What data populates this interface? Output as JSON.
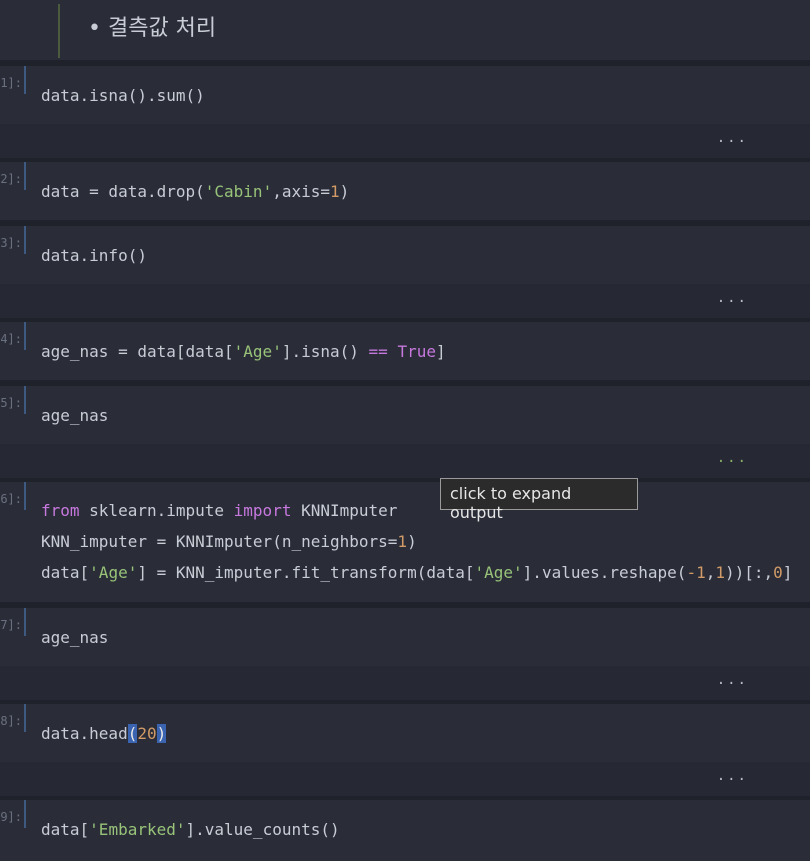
{
  "markdown": {
    "heading": "• 결측값 처리"
  },
  "cells": [
    {
      "prompt": "1]:",
      "lines": [
        [
          {
            "t": "data.isna().sum()",
            "c": ""
          }
        ]
      ],
      "output": "..."
    },
    {
      "prompt": "2]:",
      "lines": [
        [
          {
            "t": "data = data.drop(",
            "c": ""
          },
          {
            "t": "'Cabin'",
            "c": "st"
          },
          {
            "t": ",axis=",
            "c": ""
          },
          {
            "t": "1",
            "c": "nm"
          },
          {
            "t": ")",
            "c": ""
          }
        ]
      ]
    },
    {
      "prompt": "3]:",
      "lines": [
        [
          {
            "t": "data.info()",
            "c": ""
          }
        ]
      ],
      "output": "..."
    },
    {
      "prompt": "4]:",
      "lines": [
        [
          {
            "t": "age_nas = data[data[",
            "c": ""
          },
          {
            "t": "'Age'",
            "c": "st"
          },
          {
            "t": "].isna() ",
            "c": ""
          },
          {
            "t": "==",
            "c": "op"
          },
          {
            "t": " ",
            "c": ""
          },
          {
            "t": "True",
            "c": "kw"
          },
          {
            "t": "]",
            "c": ""
          }
        ]
      ]
    },
    {
      "prompt": "5]:",
      "lines": [
        [
          {
            "t": "age_nas",
            "c": ""
          }
        ]
      ],
      "output": "..."
    },
    {
      "prompt": "6]:",
      "lines": [
        [
          {
            "t": "from",
            "c": "kw"
          },
          {
            "t": " sklearn.impute ",
            "c": ""
          },
          {
            "t": "import",
            "c": "kw"
          },
          {
            "t": " KNNImputer",
            "c": ""
          }
        ],
        [
          {
            "t": "KNN_imputer = KNNImputer(n_neighbors=",
            "c": ""
          },
          {
            "t": "1",
            "c": "nm"
          },
          {
            "t": ")",
            "c": ""
          }
        ],
        [
          {
            "t": "data[",
            "c": ""
          },
          {
            "t": "'Age'",
            "c": "st"
          },
          {
            "t": "] = KNN_imputer.fit_transform(data[",
            "c": ""
          },
          {
            "t": "'Age'",
            "c": "st"
          },
          {
            "t": "].values.reshape(",
            "c": ""
          },
          {
            "t": "-1",
            "c": "nm"
          },
          {
            "t": ",",
            "c": ""
          },
          {
            "t": "1",
            "c": "nm"
          },
          {
            "t": "))[:,",
            "c": ""
          },
          {
            "t": "0",
            "c": "nm"
          },
          {
            "t": "]",
            "c": ""
          }
        ]
      ]
    },
    {
      "prompt": "7]:",
      "lines": [
        [
          {
            "t": "age_nas",
            "c": ""
          }
        ]
      ],
      "output": "..."
    },
    {
      "prompt": "8]:",
      "lines": [
        [
          {
            "t": "data.head",
            "c": ""
          },
          {
            "t": "(",
            "c": "sel"
          },
          {
            "t": "20",
            "c": "nm"
          },
          {
            "t": ")",
            "c": "sel"
          }
        ]
      ],
      "output": "..."
    },
    {
      "prompt": "9]:",
      "lines": [
        [
          {
            "t": "data[",
            "c": ""
          },
          {
            "t": "'Embarked'",
            "c": "st"
          },
          {
            "t": "].value_counts()",
            "c": ""
          }
        ]
      ]
    }
  ],
  "tooltip": "click to expand output"
}
